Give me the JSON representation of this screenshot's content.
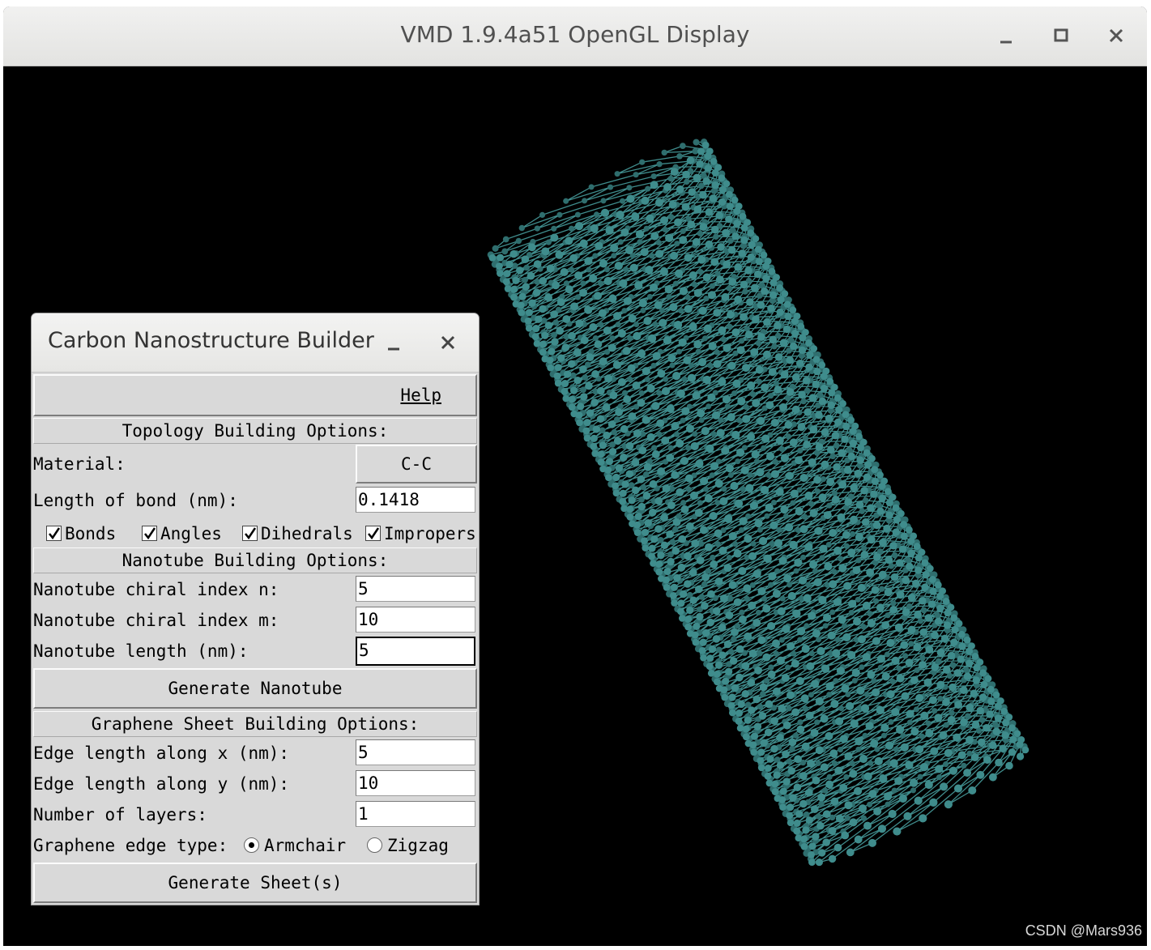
{
  "vmd": {
    "title": "VMD 1.9.4a51 OpenGL Display",
    "watermark": "CSDN @Mars936",
    "atom_color": "#3f8c8c",
    "background_color": "#000000"
  },
  "builder": {
    "title": "Carbon Nanostructure Builder",
    "help_label": "Help",
    "topology_header": "Topology Building Options:",
    "material_label": "Material:",
    "material_value": "C-C",
    "bond_length_label": "Length of bond (nm):",
    "bond_length_value": "0.1418",
    "checkboxes": [
      {
        "label": "Bonds",
        "checked": true
      },
      {
        "label": "Angles",
        "checked": true
      },
      {
        "label": "Dihedrals",
        "checked": true
      },
      {
        "label": "Impropers",
        "checked": true
      }
    ],
    "nanotube_header": "Nanotube Building Options:",
    "chiral_n_label": "Nanotube chiral index n:",
    "chiral_n_value": "5",
    "chiral_m_label": "Nanotube chiral index m:",
    "chiral_m_value": "10",
    "tube_length_label": "Nanotube length (nm):",
    "tube_length_value": "5",
    "generate_nanotube_label": "Generate Nanotube",
    "graphene_header": "Graphene Sheet Building Options:",
    "edge_x_label": "Edge length along x (nm):",
    "edge_x_value": "5",
    "edge_y_label": "Edge length along y (nm):",
    "edge_y_value": "10",
    "layers_label": "Number of layers:",
    "layers_value": "1",
    "edge_type_label": "Graphene edge type:",
    "edge_type_options": [
      "Armchair",
      "Zigzag"
    ],
    "edge_type_selected": "Armchair",
    "generate_sheet_label": "Generate Sheet(s)"
  }
}
